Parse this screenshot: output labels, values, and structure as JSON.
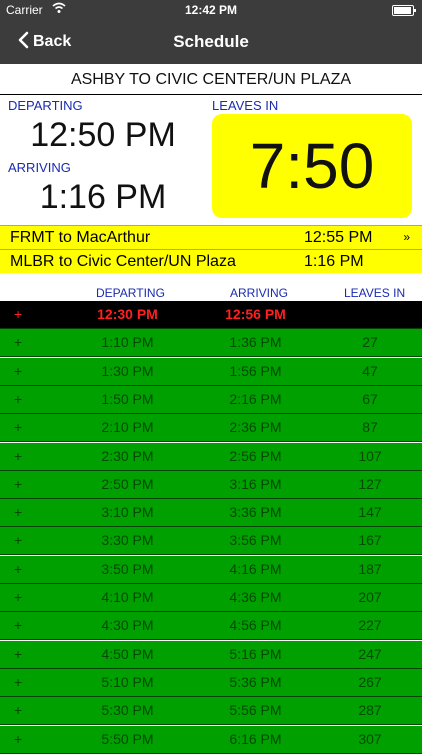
{
  "status": {
    "carrier": "Carrier",
    "time": "12:42 PM"
  },
  "nav": {
    "back": "Back",
    "title": "Schedule"
  },
  "route_title": "ASHBY TO CIVIC CENTER/UN PLAZA",
  "departing": {
    "label": "DEPARTING",
    "time": "12:50 PM"
  },
  "arriving": {
    "label": "ARRIVING",
    "time": "1:16 PM"
  },
  "leaves_in": {
    "label": "LEAVES IN",
    "countdown": "7:50"
  },
  "transfers": [
    {
      "route": "FRMT to MacArthur",
      "time": "12:55 PM",
      "more": "»"
    },
    {
      "route": "MLBR to Civic Center/UN Plaza",
      "time": "1:16 PM",
      "more": ""
    }
  ],
  "table": {
    "headers": {
      "departing": "DEPARTING",
      "arriving": "ARRIVING",
      "leaves_in": "LEAVES IN"
    },
    "rows": [
      {
        "plus": "+",
        "departing": "12:30 PM",
        "arriving": "12:56 PM",
        "leaves_in": "",
        "current": true
      },
      {
        "plus": "+",
        "departing": "1:10 PM",
        "arriving": "1:36 PM",
        "leaves_in": "27",
        "current": false
      },
      {
        "plus": "+",
        "departing": "1:30 PM",
        "arriving": "1:56 PM",
        "leaves_in": "47",
        "current": false
      },
      {
        "plus": "+",
        "departing": "1:50 PM",
        "arriving": "2:16 PM",
        "leaves_in": "67",
        "current": false
      },
      {
        "plus": "+",
        "departing": "2:10 PM",
        "arriving": "2:36 PM",
        "leaves_in": "87",
        "current": false
      },
      {
        "plus": "+",
        "departing": "2:30 PM",
        "arriving": "2:56 PM",
        "leaves_in": "107",
        "current": false
      },
      {
        "plus": "+",
        "departing": "2:50 PM",
        "arriving": "3:16 PM",
        "leaves_in": "127",
        "current": false
      },
      {
        "plus": "+",
        "departing": "3:10 PM",
        "arriving": "3:36 PM",
        "leaves_in": "147",
        "current": false
      },
      {
        "plus": "+",
        "departing": "3:30 PM",
        "arriving": "3:56 PM",
        "leaves_in": "167",
        "current": false
      },
      {
        "plus": "+",
        "departing": "3:50 PM",
        "arriving": "4:16 PM",
        "leaves_in": "187",
        "current": false
      },
      {
        "plus": "+",
        "departing": "4:10 PM",
        "arriving": "4:36 PM",
        "leaves_in": "207",
        "current": false
      },
      {
        "plus": "+",
        "departing": "4:30 PM",
        "arriving": "4:56 PM",
        "leaves_in": "227",
        "current": false
      },
      {
        "plus": "+",
        "departing": "4:50 PM",
        "arriving": "5:16 PM",
        "leaves_in": "247",
        "current": false
      },
      {
        "plus": "+",
        "departing": "5:10 PM",
        "arriving": "5:36 PM",
        "leaves_in": "267",
        "current": false
      },
      {
        "plus": "+",
        "departing": "5:30 PM",
        "arriving": "5:56 PM",
        "leaves_in": "287",
        "current": false
      },
      {
        "plus": "+",
        "departing": "5:50 PM",
        "arriving": "6:16 PM",
        "leaves_in": "307",
        "current": false
      }
    ]
  }
}
